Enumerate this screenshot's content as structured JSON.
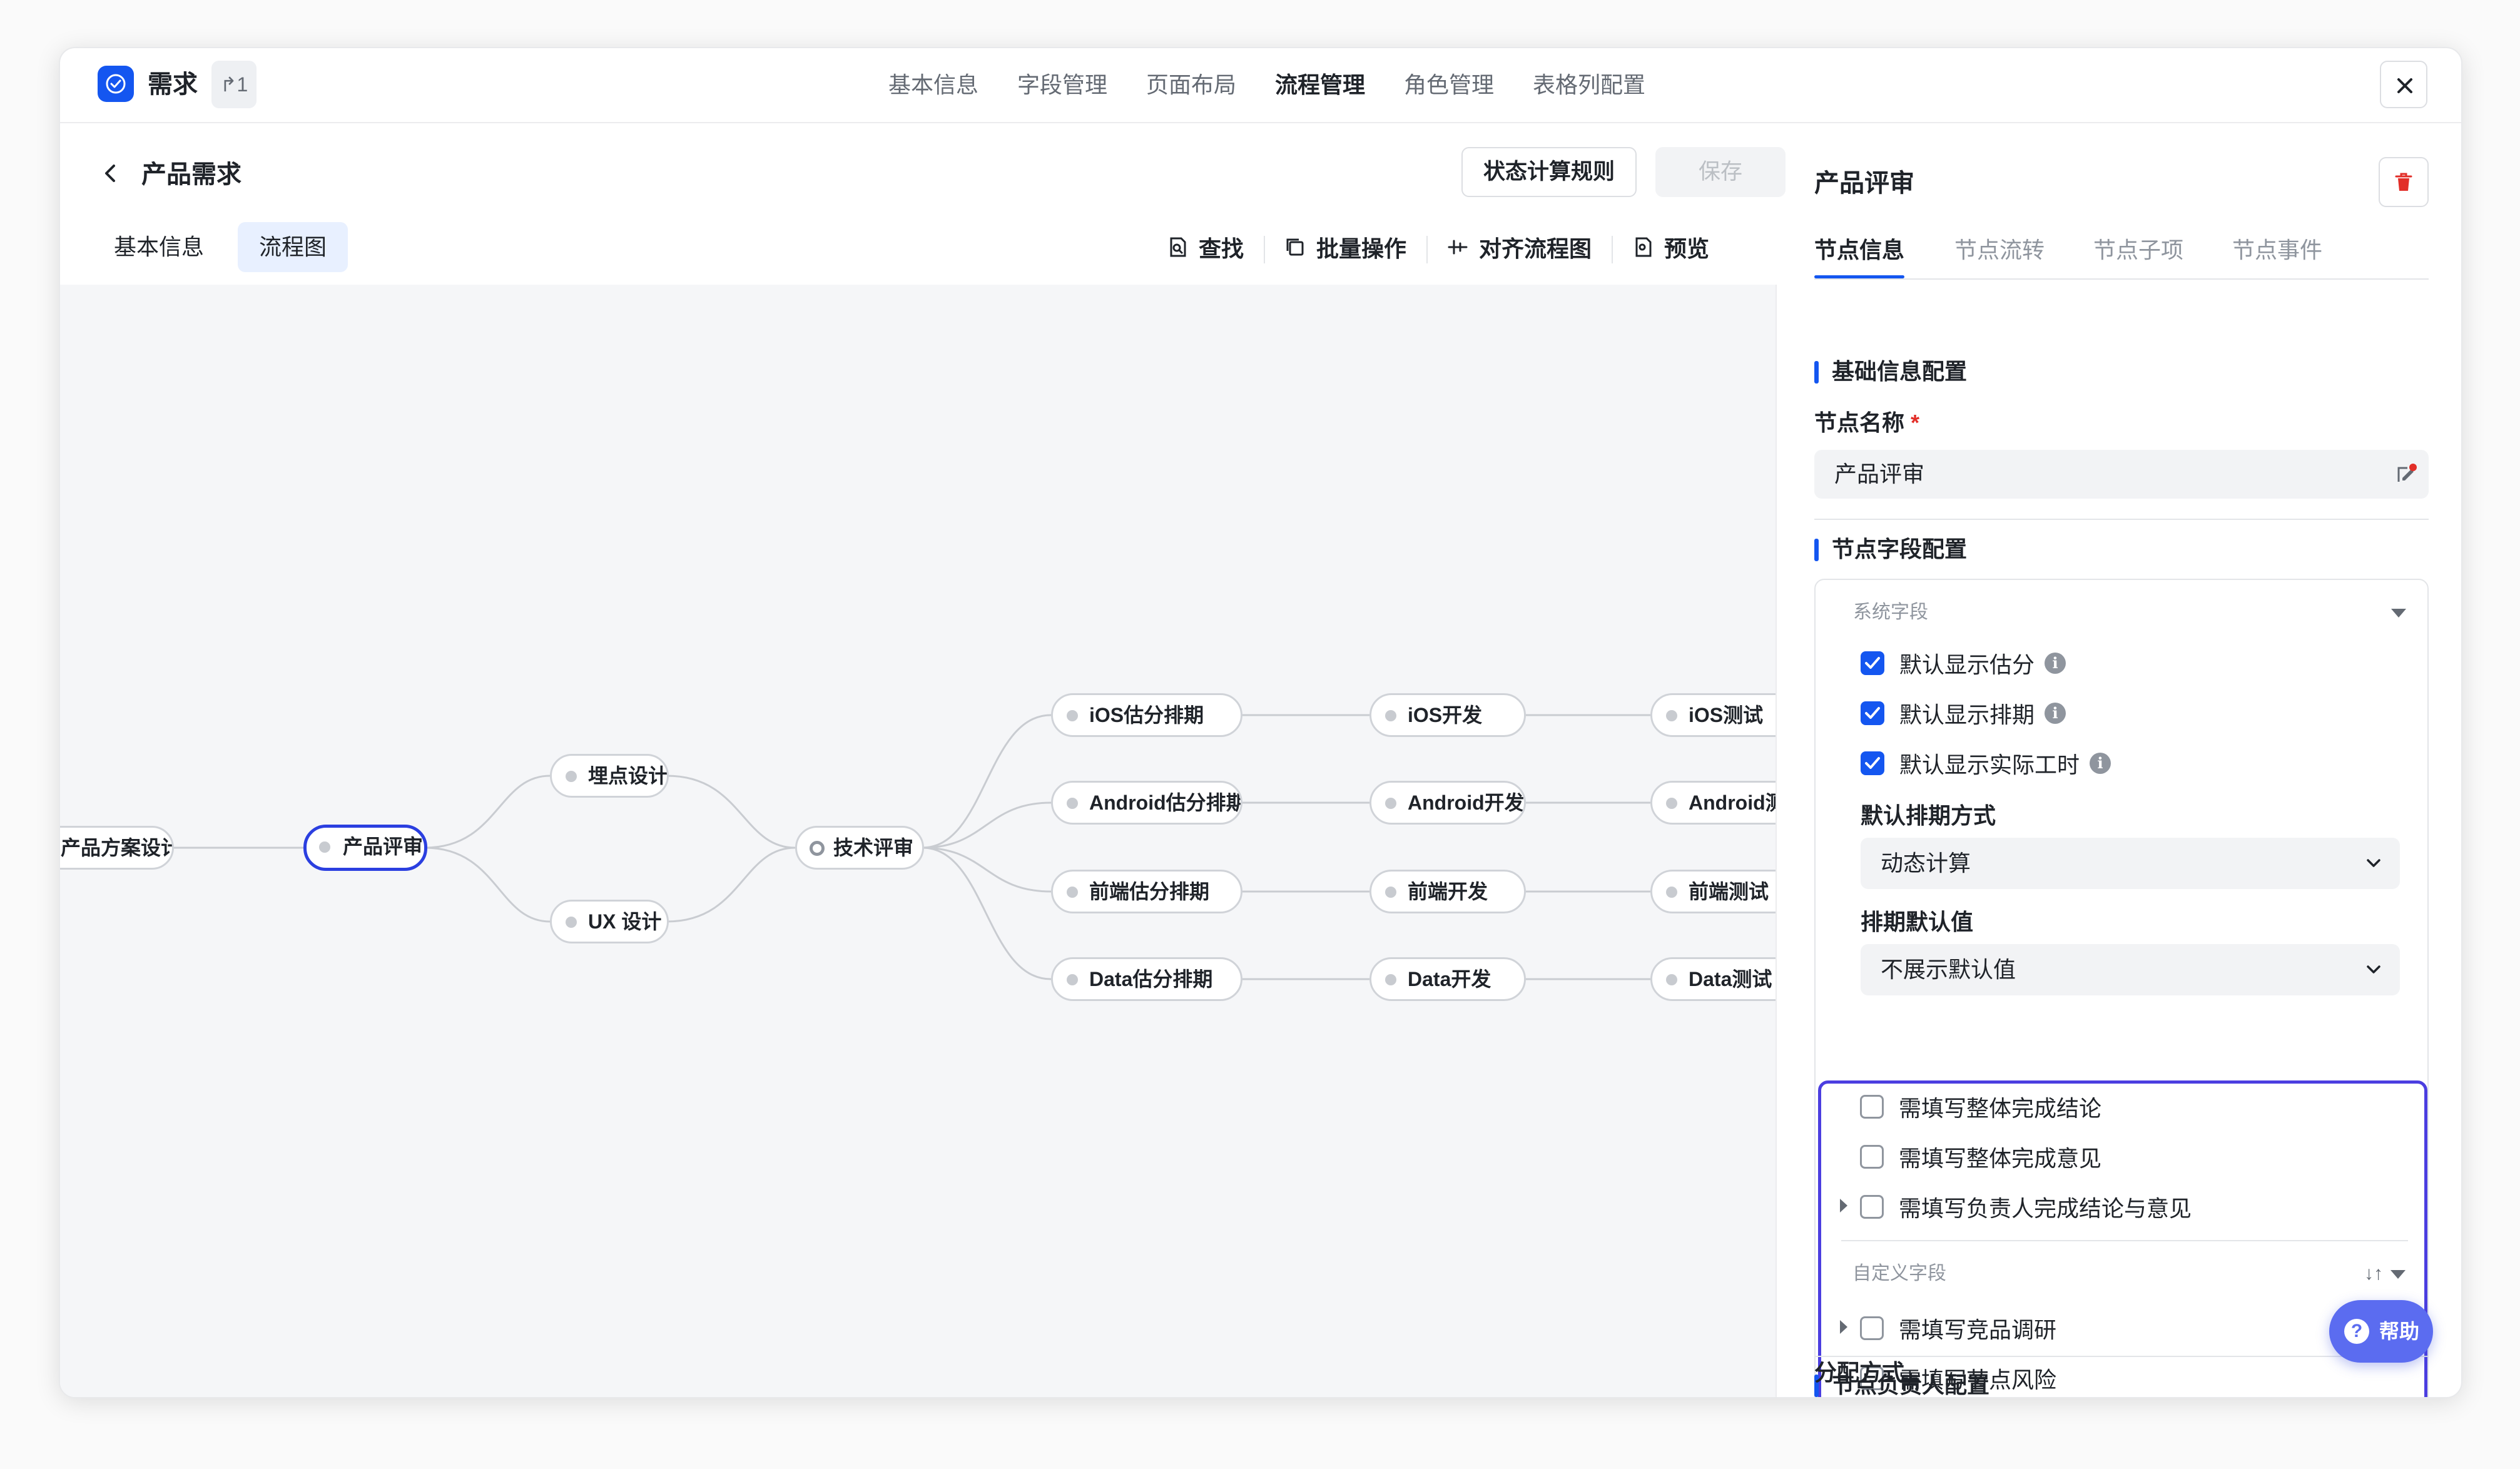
{
  "app": {
    "name": "需求",
    "share_count": "1"
  },
  "nav": {
    "tabs": [
      "基本信息",
      "字段管理",
      "页面布局",
      "流程管理",
      "角色管理",
      "表格列配置"
    ],
    "active": "流程管理"
  },
  "left": {
    "title": "产品需求",
    "rule_button": "状态计算规则",
    "save_button": "保存",
    "subtabs": [
      "基本信息",
      "流程图"
    ],
    "toolbar": [
      "查找",
      "批量操作",
      "对齐流程图",
      "预览"
    ]
  },
  "flow": {
    "nodes": {
      "n0": "产品方案设计",
      "n1": "产品评审",
      "n2": "埋点设计",
      "n3": "UX 设计",
      "n4": "技术评审",
      "n5": "iOS估分排期",
      "n6": "Android估分排期",
      "n7": "前端估分排期",
      "n8": "Data估分排期",
      "n9": "iOS开发",
      "n10": "Android开发",
      "n11": "前端开发",
      "n12": "Data开发",
      "n13": "iOS测试",
      "n14": "Android测试",
      "n15": "前端测试",
      "n16": "Data测试"
    }
  },
  "panel": {
    "title": "产品评审",
    "tabs": [
      "节点信息",
      "节点流转",
      "节点子项",
      "节点事件"
    ],
    "basic_section": "基础信息配置",
    "node_name_label": "节点名称",
    "required_mark": "*",
    "node_name_value": "产品评审",
    "field_section": "节点字段配置",
    "system_group": "系统字段",
    "checks": {
      "c1": "默认显示估分",
      "c2": "默认显示排期",
      "c3": "默认显示实际工时"
    },
    "schedule_mode_label": "默认排期方式",
    "schedule_mode_value": "动态计算",
    "schedule_default_label": "排期默认值",
    "schedule_default_value": "不展示默认值",
    "items": {
      "i1": "需填写整体完成结论",
      "i2": "需填写整体完成意见",
      "i3": "需填写负责人完成结论与意见",
      "i4": "需填写竞品调研",
      "i5": "需填写节点风险"
    },
    "custom_group": "自定义字段",
    "sort_icon": "↓↑",
    "owner_section": "节点负责人配置",
    "assign_label": "分配方式",
    "help": "帮助",
    "help_icon": "?",
    "info_icon": "i"
  }
}
